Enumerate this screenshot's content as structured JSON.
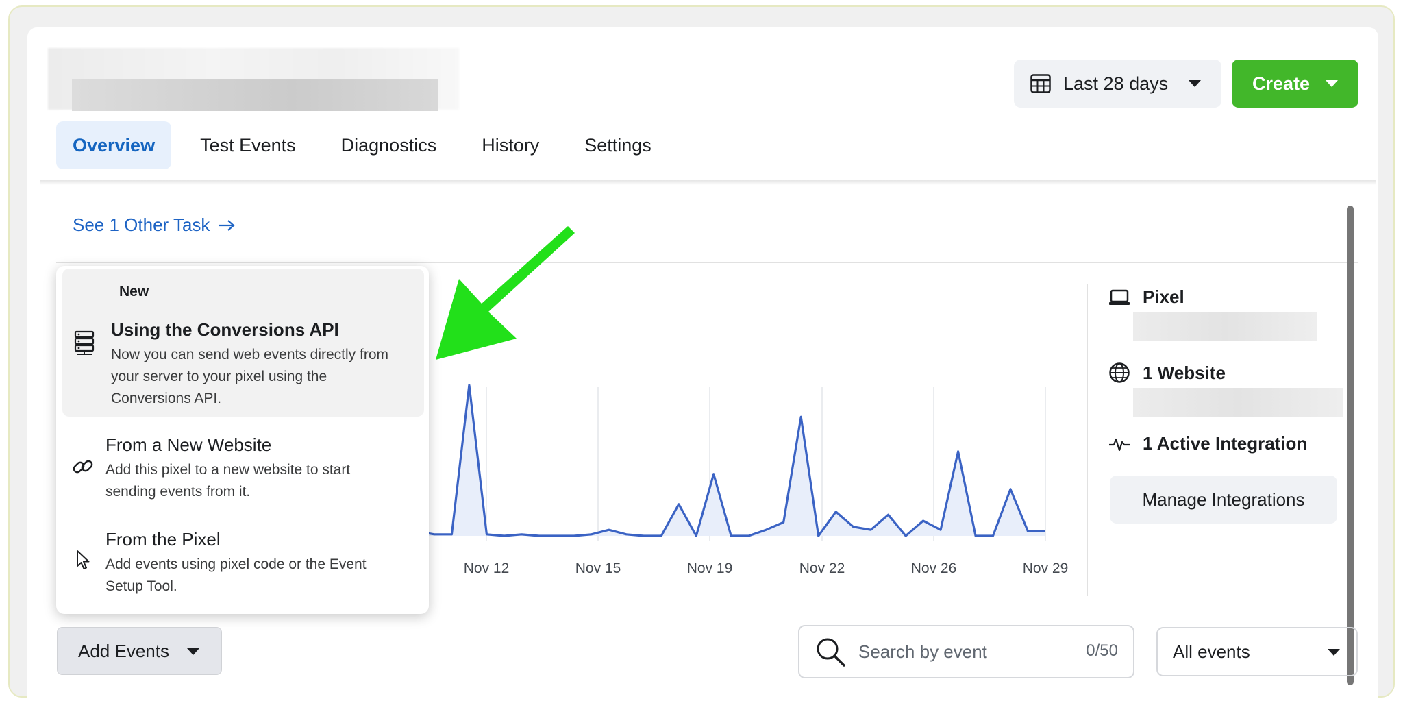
{
  "header": {
    "date_range": "Last 28 days",
    "create_label": "Create"
  },
  "tabs": [
    {
      "label": "Overview",
      "active": true
    },
    {
      "label": "Test Events",
      "active": false
    },
    {
      "label": "Diagnostics",
      "active": false
    },
    {
      "label": "History",
      "active": false
    },
    {
      "label": "Settings",
      "active": false
    }
  ],
  "other_task_link": "See 1 Other Task",
  "menu": {
    "new_label": "New",
    "items": [
      {
        "icon": "server-icon",
        "title": "Using the Conversions API",
        "description": "Now you can send web events directly from your server to your pixel using the Conversions API."
      },
      {
        "icon": "link-icon",
        "title": "From a New Website",
        "description": "Add this pixel to a new website to start sending events from it."
      },
      {
        "icon": "pointer-icon",
        "title": "From the Pixel",
        "description": "Add events using pixel code or the Event Setup Tool."
      }
    ]
  },
  "info": {
    "pixel_label": "Pixel",
    "website_label": "1 Website",
    "integration_label": "1 Active Integration",
    "manage_button": "Manage Integrations"
  },
  "toolbar": {
    "add_events_label": "Add Events",
    "search_placeholder": "Search by event",
    "search_count": "0/50",
    "filter_value": "All events"
  },
  "colors": {
    "accent_blue": "#1d63c4",
    "create_green": "#42b72a",
    "chart_line": "#3b63c4",
    "annotation_arrow": "#22e01a"
  },
  "chart_data": {
    "type": "area",
    "x_tick_labels": [
      "Nov 12",
      "Nov 15",
      "Nov 19",
      "Nov 22",
      "Nov 26",
      "Nov 29"
    ],
    "grid": true,
    "x": [
      "Nov 9",
      "Nov 9",
      "Nov 10",
      "Nov 10",
      "Nov 11",
      "Nov 11",
      "Nov 12",
      "Nov 12",
      "Nov 13",
      "Nov 14",
      "Nov 14",
      "Nov 15",
      "Nov 15",
      "Nov 16",
      "Nov 16",
      "Nov 17",
      "Nov 17",
      "Nov 18",
      "Nov 18",
      "Nov 19",
      "Nov 19",
      "Nov 20",
      "Nov 20",
      "Nov 21",
      "Nov 22",
      "Nov 22",
      "Nov 23",
      "Nov 23",
      "Nov 24",
      "Nov 24",
      "Nov 25",
      "Nov 25",
      "Nov 26",
      "Nov 26",
      "Nov 27",
      "Nov 27",
      "Nov 28",
      "Nov 28",
      "Nov 29",
      "Nov 29"
    ],
    "values": [
      0,
      1,
      0,
      3,
      1,
      1,
      100,
      1,
      0,
      1,
      0,
      0,
      0,
      1,
      4,
      1,
      0,
      0,
      21,
      0,
      41,
      0,
      0,
      4,
      9,
      79,
      0,
      16,
      6,
      4,
      14,
      0,
      10,
      4,
      56,
      0,
      0,
      31,
      3,
      3
    ]
  }
}
